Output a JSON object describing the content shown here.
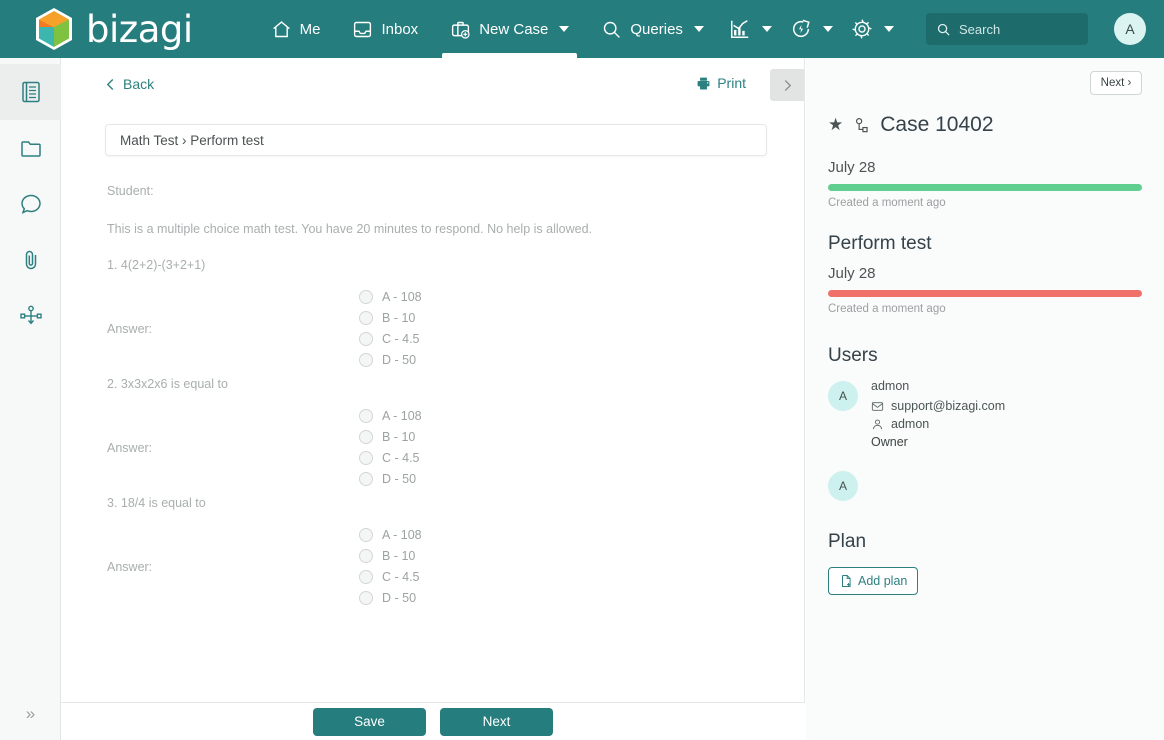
{
  "topbar": {
    "brand": "bizagi",
    "nav": [
      {
        "label": "Me",
        "icon": "home-icon",
        "has_caret": false,
        "active": false
      },
      {
        "label": "Inbox",
        "icon": "inbox-icon",
        "has_caret": false,
        "active": false
      },
      {
        "label": "New Case",
        "icon": "briefcase-plus-icon",
        "has_caret": true,
        "active": true
      },
      {
        "label": "Queries",
        "icon": "search-icon",
        "has_caret": true,
        "active": false
      }
    ],
    "icon_buttons": [
      {
        "icon": "analytics-chart-icon",
        "has_caret": true
      },
      {
        "icon": "refresh-lightning-icon",
        "has_caret": true
      },
      {
        "icon": "gear-icon",
        "has_caret": true
      }
    ],
    "search_placeholder": "Search",
    "search_value": "",
    "avatar_initial": "A",
    "bg_color": "#257d7d"
  },
  "rail": {
    "items": [
      {
        "icon": "form-document-icon",
        "active": true
      },
      {
        "icon": "folder-icon",
        "active": false
      },
      {
        "icon": "comment-bubble-icon",
        "active": false
      },
      {
        "icon": "paperclip-icon",
        "active": false
      },
      {
        "icon": "process-flow-icon",
        "active": false
      }
    ],
    "expand_label": "»"
  },
  "main": {
    "back_label": "Back",
    "print_label": "Print",
    "panel_toggle_icon": "chevron-right-icon",
    "breadcrumb": "Math Test › Perform test",
    "student_label": "Student:",
    "intro": "This is a multiple choice math test. You have 20 minutes to respond. No help is allowed.",
    "answer_label": "Answer:",
    "questions": [
      {
        "text": "1. 4(2+2)-(3+2+1)",
        "options": [
          "A - 108",
          "B - 10",
          "C - 4.5",
          "D - 50"
        ]
      },
      {
        "text": "2. 3x3x2x6 is equal to",
        "options": [
          "A - 108",
          "B - 10",
          "C - 4.5",
          "D - 50"
        ]
      },
      {
        "text": "3. 18/4 is equal to",
        "options": [
          "A - 108",
          "B - 10",
          "C - 4.5",
          "D - 50"
        ]
      }
    ],
    "save_label": "Save",
    "next_label": "Next"
  },
  "rightpanel": {
    "next_label": "Next ›",
    "case_title": "Case 10402",
    "case_date": "July 28",
    "case_progress_caption": "Created a moment ago",
    "case_progress_color": "#5fce8e",
    "stage_title": "Perform test",
    "stage_date": "July 28",
    "stage_progress_caption": "Created a moment ago",
    "stage_progress_color": "#f0706a",
    "users_title": "Users",
    "users": [
      {
        "initial": "A",
        "name": "admon",
        "email": "support@bizagi.com",
        "account": "admon",
        "role": "Owner"
      },
      {
        "initial": "A",
        "name": "",
        "email": "",
        "account": "",
        "role": ""
      }
    ],
    "plan_title": "Plan",
    "add_plan_label": "Add plan"
  }
}
